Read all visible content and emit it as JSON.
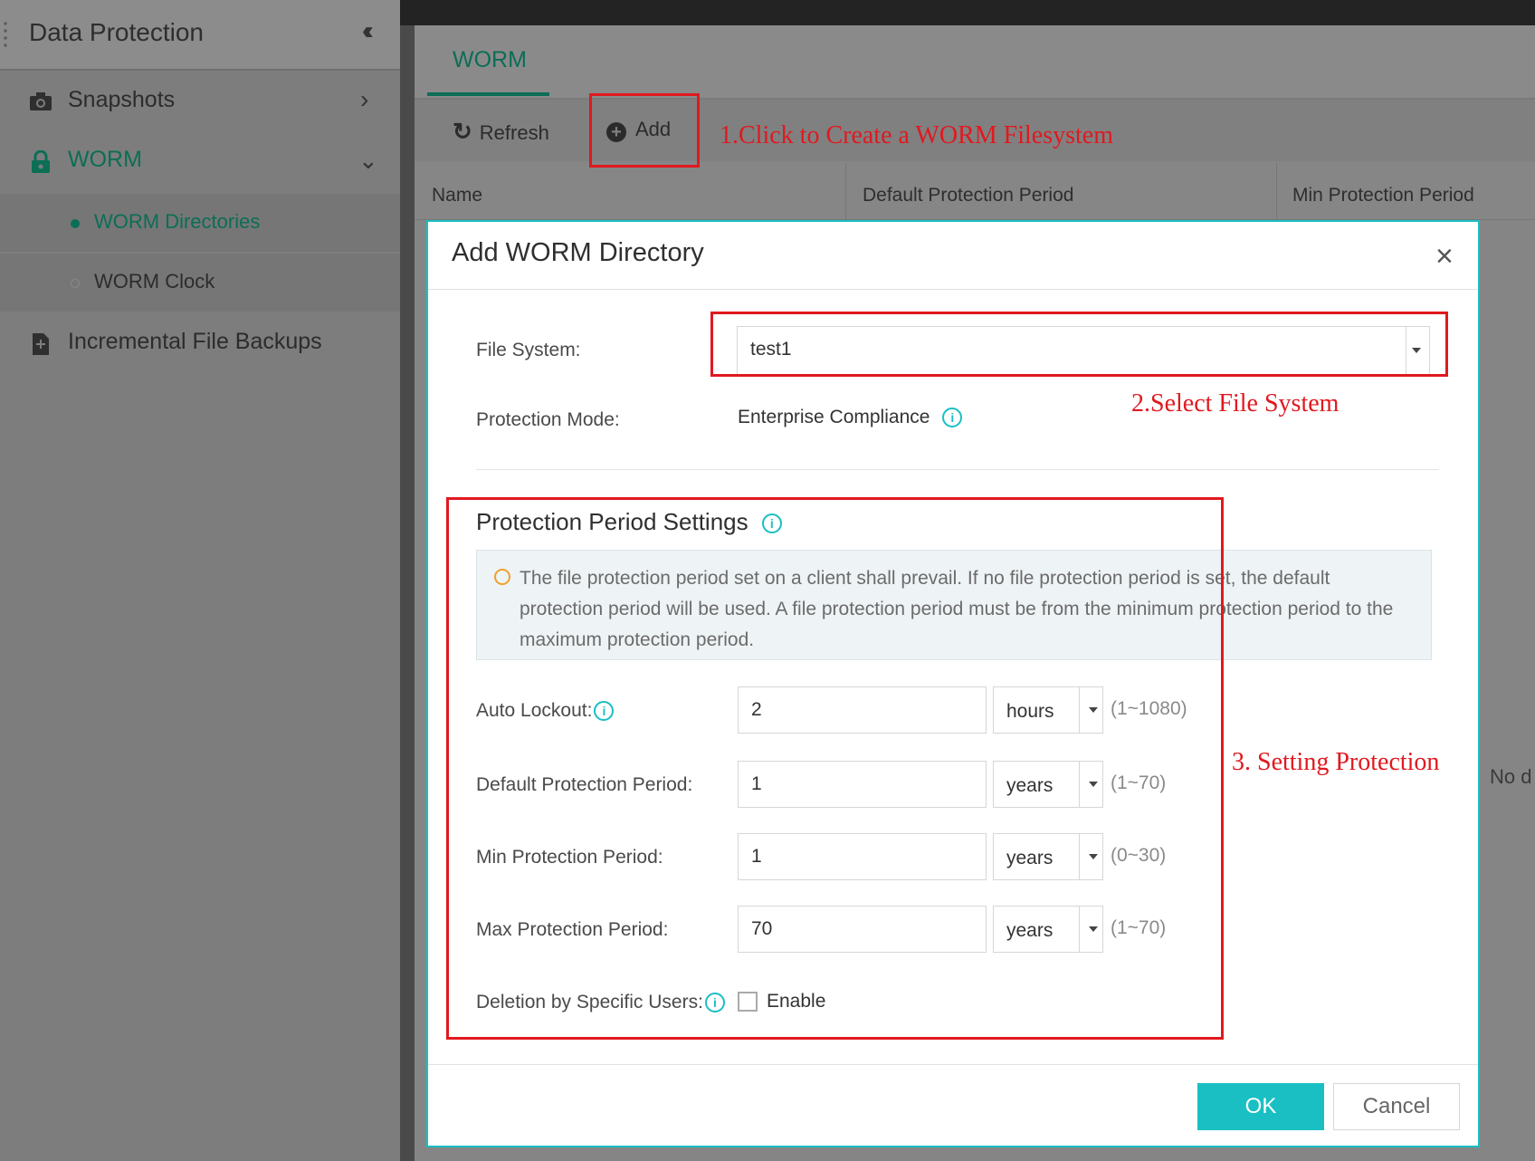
{
  "sidebar": {
    "title": "Data Protection",
    "collapse_icon": "double-chevron-left",
    "items": [
      {
        "label": "Snapshots",
        "icon": "camera-icon"
      },
      {
        "label": "WORM",
        "icon": "lock-icon"
      },
      {
        "label": "Incremental File Backups",
        "icon": "file-icon"
      }
    ],
    "worm_subitems": [
      {
        "label": "WORM Directories",
        "active": true
      },
      {
        "label": "WORM Clock",
        "active": false
      }
    ]
  },
  "main": {
    "tab": "WORM",
    "toolbar": {
      "refresh": "Refresh",
      "add": "Add"
    },
    "table_headers": [
      "Name",
      "Default Protection Period",
      "Min Protection Period"
    ],
    "no_data": "No d"
  },
  "dialog": {
    "title": "Add WORM Directory",
    "close_glyph": "×",
    "file_system_label": "File System:",
    "file_system_value": "test1",
    "protection_mode_label": "Protection Mode:",
    "protection_mode_value": "Enterprise Compliance",
    "pps_title": "Protection Period Settings",
    "notice": "The file protection period set on a client shall prevail. If no file protection period is set, the default protection period will be used. A file protection period must be from the minimum protection period to the maximum protection period.",
    "fields": [
      {
        "label": "Auto Lockout:",
        "value": "2",
        "unit": "hours",
        "range": "(1~1080)"
      },
      {
        "label": "Default Protection Period:",
        "value": "1",
        "unit": "years",
        "range": "(1~70)"
      },
      {
        "label": "Min Protection Period:",
        "value": "1",
        "unit": "years",
        "range": "(0~30)"
      },
      {
        "label": "Max Protection Period:",
        "value": "70",
        "unit": "years",
        "range": "(1~70)"
      }
    ],
    "deletion_label": "Deletion by Specific Users:",
    "enable_label": "Enable",
    "ok": "OK",
    "cancel": "Cancel"
  },
  "annotations": {
    "step1": "1.Click to Create a WORM Filesystem",
    "step2": "2.Select File System",
    "step3": "3. Setting Protection"
  },
  "colors": {
    "accent": "#19bfc3",
    "green": "#0b6e55",
    "annotation": "#e0191f"
  }
}
